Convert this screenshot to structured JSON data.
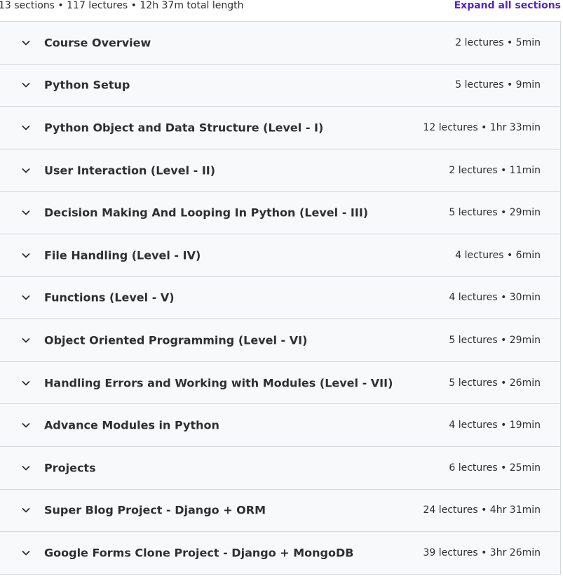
{
  "summary": "13 sections • 117 lectures • 12h 37m total length",
  "expand_all_label": "Expand all sections",
  "sections": [
    {
      "title": "Course Overview",
      "meta": "2 lectures • 5min",
      "icon": "chevron-down-icon"
    },
    {
      "title": "Python Setup",
      "meta": "5 lectures • 9min",
      "icon": "chevron-down-icon"
    },
    {
      "title": "Python Object and Data Structure (Level - I)",
      "meta": "12 lectures • 1hr 33min",
      "icon": "chevron-down-icon"
    },
    {
      "title": "User Interaction (Level - II)",
      "meta": "2 lectures • 11min",
      "icon": "chevron-down-icon"
    },
    {
      "title": "Decision Making And Looping In Python (Level - III)",
      "meta": "5 lectures • 29min",
      "icon": "chevron-down-icon"
    },
    {
      "title": "File Handling (Level - IV)",
      "meta": "4 lectures • 6min",
      "icon": "chevron-down-icon"
    },
    {
      "title": "Functions (Level - V)",
      "meta": "4 lectures • 30min",
      "icon": "chevron-down-icon"
    },
    {
      "title": "Object Oriented Programming (Level - VI)",
      "meta": "5 lectures • 29min",
      "icon": "chevron-down-icon"
    },
    {
      "title": "Handling Errors and Working with Modules (Level - VII)",
      "meta": "5 lectures • 26min",
      "icon": "chevron-down-icon"
    },
    {
      "title": "Advance Modules in Python",
      "meta": "4 lectures • 19min",
      "icon": "chevron-down-icon"
    },
    {
      "title": "Projects",
      "meta": "6 lectures • 25min",
      "icon": "chevron-down-icon"
    },
    {
      "title": "Super Blog Project - Django + ORM",
      "meta": "24 lectures • 4hr 31min",
      "icon": "chevron-down-icon"
    },
    {
      "title": "Google Forms Clone Project - Django + MongoDB",
      "meta": "39 lectures • 3hr 26min",
      "icon": "chevron-down-icon"
    }
  ],
  "colors": {
    "accent": "#5624d0",
    "text": "#2d2f31",
    "row_bg": "#f7f9fa",
    "border": "#d1d7dc"
  }
}
